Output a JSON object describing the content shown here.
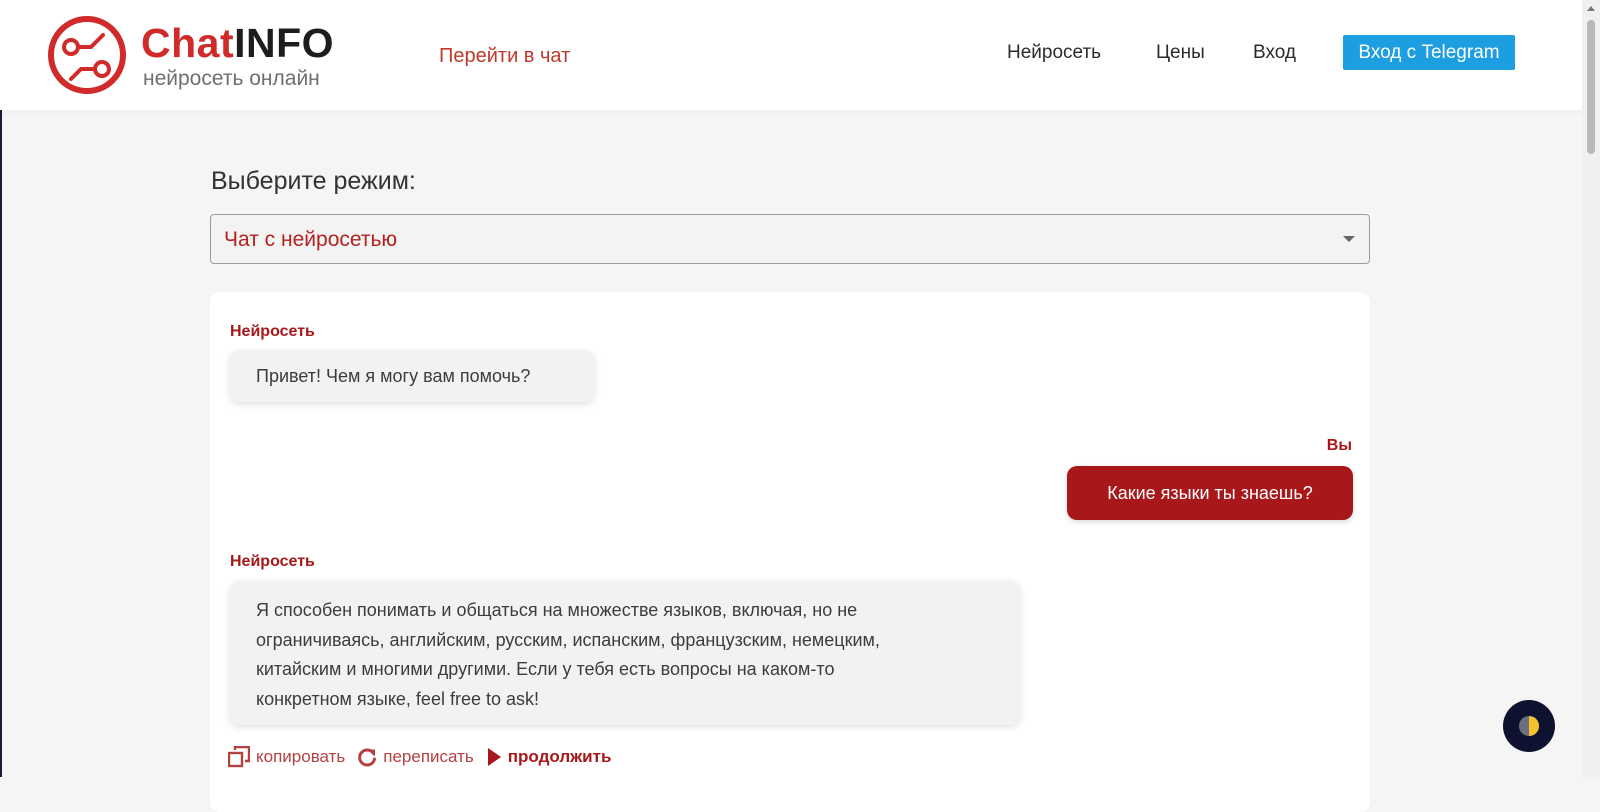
{
  "header": {
    "logo_title_part1": "Chat",
    "logo_title_part2": "INFO",
    "logo_subtitle": "нейросеть онлайн",
    "goto_chat": "Перейти в чат",
    "nav": [
      "Нейросеть",
      "Цены",
      "Вход"
    ],
    "telegram_button": "Вход с Telegram"
  },
  "mode": {
    "label": "Выберите режим:",
    "selected": "Чат с нейросетью"
  },
  "chat": {
    "messages": [
      {
        "sender": "Нейросеть",
        "text": "Привет! Чем я могу вам помочь?"
      },
      {
        "sender": "Вы",
        "text": "Какие языки ты знаешь?"
      },
      {
        "sender": "Нейросеть",
        "lines": [
          "Я способен понимать и общаться на множестве языков, включая, но не",
          "ограничиваясь, английским, русским, испанским, французским, немецким,",
          "китайским и многими другими. Если у тебя есть вопросы на каком-то",
          "конкретном языке, feel free to ask!"
        ]
      }
    ],
    "actions": {
      "copy": "копировать",
      "rewrite": "переписать",
      "continue": "продолжить"
    }
  },
  "colors": {
    "brand_red": "#d02a2a",
    "dark_red": "#a8181b",
    "telegram_blue": "#1d9ee0",
    "theme_button": "#0f1130"
  },
  "icons": [
    "logo-circuit-icon",
    "copy-icon",
    "rewrite-icon",
    "continue-play-icon",
    "theme-toggle-icon",
    "chevron-down-icon"
  ]
}
